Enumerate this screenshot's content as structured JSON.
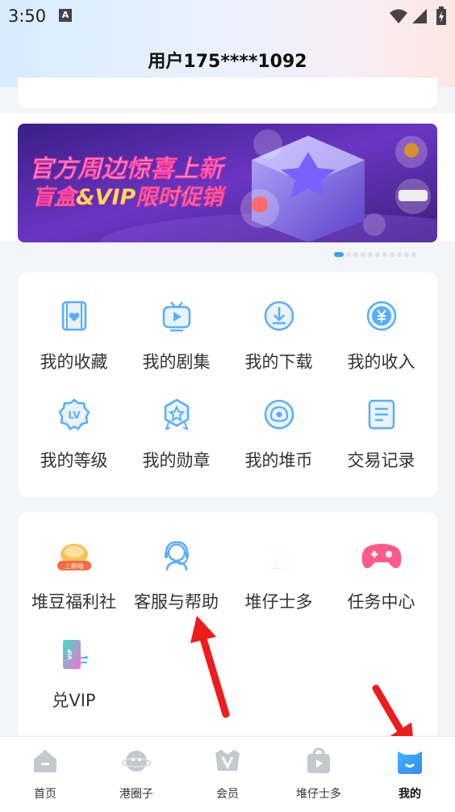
{
  "status": {
    "time": "3:50",
    "sim_badge": "A"
  },
  "header": {
    "title": "用户175****1092"
  },
  "banner": {
    "line1": "官方周边惊喜上新",
    "line2": "盲盒&VIP限时促销",
    "dots_count": 11,
    "active_dot": 0
  },
  "menu1": [
    {
      "label": "我的收藏",
      "icon": "favorites-icon"
    },
    {
      "label": "我的剧集",
      "icon": "tv-icon"
    },
    {
      "label": "我的下载",
      "icon": "download-icon"
    },
    {
      "label": "我的收入",
      "icon": "income-icon"
    },
    {
      "label": "我的等级",
      "icon": "level-icon"
    },
    {
      "label": "我的勋章",
      "icon": "medal-icon"
    },
    {
      "label": "我的堆币",
      "icon": "coin-icon"
    },
    {
      "label": "交易记录",
      "icon": "record-icon"
    }
  ],
  "menu2": [
    {
      "label": "堆豆福利社",
      "icon": "welfare-icon",
      "badge": "上新啦"
    },
    {
      "label": "客服与帮助",
      "icon": "support-icon"
    },
    {
      "label": "堆仔士多",
      "icon": "store-logo-icon",
      "logo_text": [
        "堆仔",
        "士多"
      ]
    },
    {
      "label": "任务中心",
      "icon": "gamepad-icon"
    },
    {
      "label": "兑VIP",
      "icon": "vip-card-icon",
      "card_text": "VIP"
    }
  ],
  "tabbar": {
    "tabs": [
      {
        "label": "首页",
        "icon": "home-icon",
        "active": false
      },
      {
        "label": "港圈子",
        "icon": "planet-icon",
        "active": false
      },
      {
        "label": "会员",
        "icon": "vip-icon",
        "active": false
      },
      {
        "label": "堆仔士多",
        "icon": "shop-bag-icon",
        "active": false
      },
      {
        "label": "我的",
        "icon": "profile-icon",
        "active": true
      }
    ]
  },
  "colors": {
    "accent": "#3aa3ff",
    "icon_blue": "#5aaef7",
    "arrow_red": "#ee1c1c"
  }
}
